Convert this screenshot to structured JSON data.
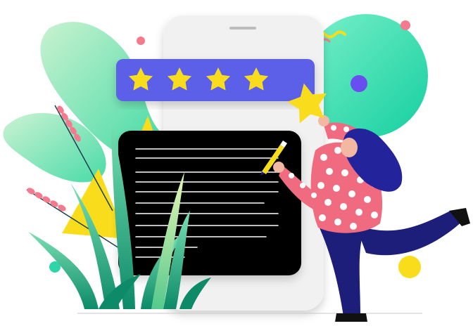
{
  "illustration": {
    "subject": "person-adding-star-to-rating",
    "rating": {
      "filled_stars": 5,
      "total_stars": 5
    },
    "icons": [
      "star-icon",
      "phone",
      "review-card",
      "pencil-icon",
      "plant"
    ]
  },
  "colors": {
    "background": "#ffffff",
    "rating_bar": "#5b5fe8",
    "star": "#f9dd1d",
    "phone": "#f1f1f1",
    "review_card": "#000000",
    "mint_gradient_start": "#a7f3d0",
    "mint_gradient_end": "#10d9a8",
    "shirt": "#f16b80",
    "pants": "#1c1e7a",
    "hair": "#23249b",
    "grass": "#1aa37a",
    "accent_pink": "#f47a8e",
    "accent_violet": "#6a4df0"
  }
}
